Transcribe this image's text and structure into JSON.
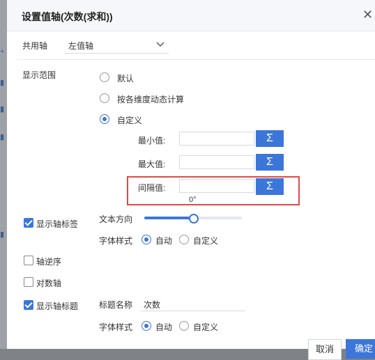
{
  "dialog": {
    "title": "设置值轴(次数(求和))",
    "shared_axis_label": "共用轴",
    "shared_axis_value": "左值轴",
    "display_range_label": "显示范围",
    "range_options": [
      "默认",
      "按各维度动态计算",
      "自定义"
    ],
    "range_selected": "自定义",
    "min_label": "最小值:",
    "max_label": "最大值:",
    "interval_label": "间隔值:",
    "sigma_label": "Σ",
    "show_axis_label": "显示轴标签",
    "text_direction_label": "文本方向",
    "text_direction_value": "0°",
    "text_direction_fraction": 0.5,
    "font_style_label": "字体样式",
    "font_style_options": [
      "自动",
      "自定义"
    ],
    "reverse_axis_label": "轴逆序",
    "log_axis_label": "对数轴",
    "show_axis_title": "显示轴标题",
    "title_name_label": "标题名称",
    "title_name_value": "次数",
    "cancel_label": "取消",
    "ok_label": "确定",
    "accent_color": "#3c76d8",
    "highlight_color": "#e0474a"
  }
}
